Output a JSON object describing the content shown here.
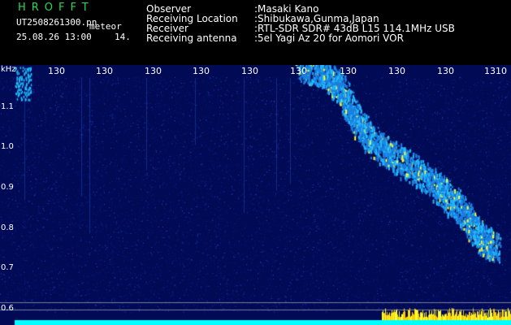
{
  "header": {
    "logo": "HROFFT",
    "filename": "UT2508261300.pn",
    "mode": "meteor",
    "datetime": "25.08.26 13:00",
    "frame": "14.",
    "rows": [
      {
        "label": "Observer",
        "value": ":Masaki Kano"
      },
      {
        "label": "Receiving Location",
        "value": ":Shibukawa,Gunma,Japan"
      },
      {
        "label": "Receiver",
        "value": ":RTL-SDR SDR# 43dB L15 114.1MHz USB"
      },
      {
        "label": "Receiving antenna",
        "value": ":5el Yagi Az 20 for Aomori VOR"
      }
    ]
  },
  "spectrogram": {
    "unit_label": "kHz",
    "y_ticks": [
      {
        "label": "1.1",
        "value": 1.1
      },
      {
        "label": "1.0",
        "value": 1.0
      },
      {
        "label": "0.9",
        "value": 0.9
      },
      {
        "label": "0.8",
        "value": 0.8
      },
      {
        "label": "0.7",
        "value": 0.7
      },
      {
        "label": "0.6",
        "value": 0.6
      }
    ],
    "x_ticks": [
      "130",
      "130",
      "130",
      "130",
      "130",
      "130",
      "130",
      "130",
      "130",
      "1310"
    ],
    "colors": {
      "background": "#000a55",
      "signal": "#22bbff",
      "peak": "#ffff33",
      "trace": "#00ffff",
      "marker": "#ffcc00"
    }
  }
}
